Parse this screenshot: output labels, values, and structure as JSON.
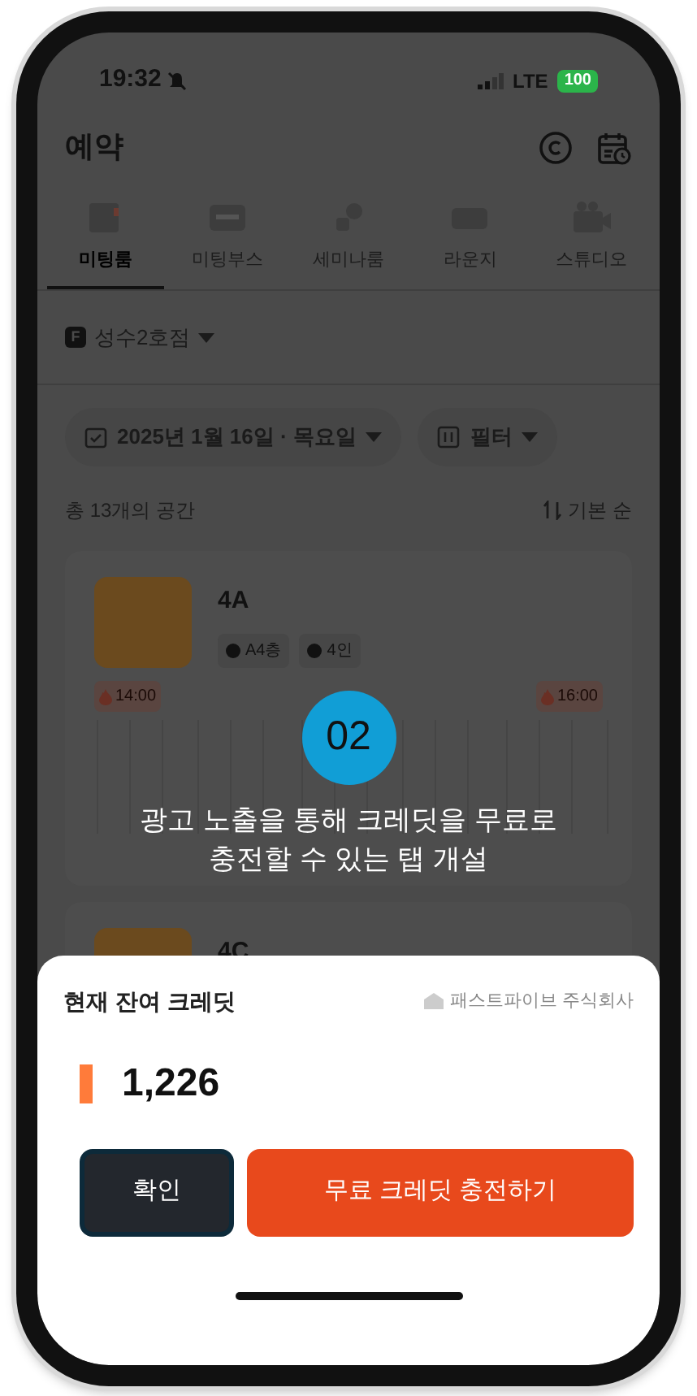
{
  "status_bar": {
    "time": "19:32",
    "network": "LTE",
    "battery": "100"
  },
  "header": {
    "title": "예약"
  },
  "tabs": [
    {
      "label": "미팅룸",
      "selected": true
    },
    {
      "label": "미팅부스",
      "selected": false
    },
    {
      "label": "세미나룸",
      "selected": false
    },
    {
      "label": "라운지",
      "selected": false
    },
    {
      "label": "스튜디오",
      "selected": false
    }
  ],
  "branch": {
    "badge": "F",
    "name": "성수2호점"
  },
  "filters": {
    "date": "2025년 1월 16일 · 목요일",
    "filter": "필터"
  },
  "list_header": {
    "count": "총 13개의 공간",
    "sort": "기본 순"
  },
  "spaces": [
    {
      "name": "4A",
      "tags": [
        "A4층",
        "4인"
      ],
      "slots": [
        "14:00",
        "16:00"
      ]
    },
    {
      "name": "4C"
    }
  ],
  "coach": {
    "step": "02",
    "lines": [
      "광고 노출을 통해 크레딧을 무료로",
      "충전할 수 있는 탭 개설"
    ]
  },
  "sheet": {
    "title": "현재 잔여 크레딧",
    "company": "패스트파이브 주식회사",
    "credits": "1,226",
    "buttons": [
      {
        "label": "확인",
        "kind": "secondary"
      },
      {
        "label": "무료 크레딧 충전하기",
        "kind": "primary"
      }
    ]
  }
}
